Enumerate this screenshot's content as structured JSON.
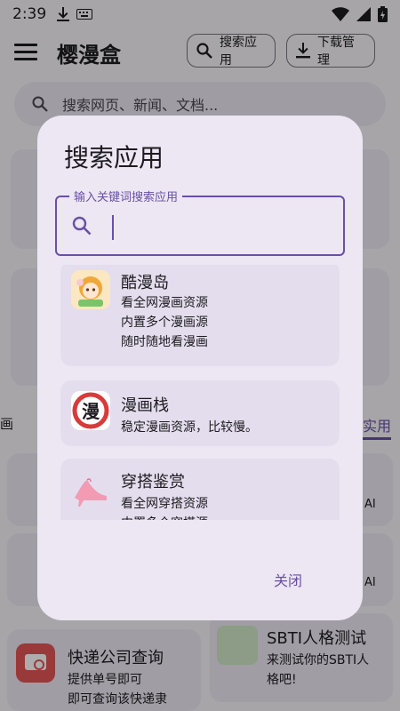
{
  "status": {
    "time": "2:39"
  },
  "app": {
    "title": "樱漫盒"
  },
  "toolbar": {
    "search_label": "搜索应用",
    "download_label": "下载管理"
  },
  "websearch": {
    "placeholder": "搜索网页、新闻、文档..."
  },
  "background": {
    "tab_right": "实用",
    "tab_left": "画",
    "card_app_name": "快递公司查询",
    "card_app_desc": "提供单号即可\n即可查询该快递隶",
    "card_sbti_name": "SBTI人格测试",
    "card_sbti_desc": "来测试你的SBTI人\n格吧!",
    "ai1": "AI",
    "ai2": "AI"
  },
  "dialog": {
    "title": "搜索应用",
    "field_label": "输入关键词搜索应用",
    "input_value": "",
    "close_label": "关闭",
    "results": [
      {
        "name": "酷漫岛",
        "desc": "看全网漫画资源\n内置多个漫画源\n随时随地看漫画",
        "icon": "anime-girl-icon"
      },
      {
        "name": "漫画栈",
        "desc": "稳定漫画资源，比较慢。",
        "icon": "manhua-seal-icon"
      },
      {
        "name": "穿搭鉴赏",
        "desc": "看全网穿搭资源\n内置多个穿搭源",
        "icon": "high-heel-icon"
      }
    ]
  },
  "colors": {
    "accent": "#6750a4",
    "dialog_bg": "#ede6f3",
    "item_bg": "#e4dded"
  }
}
